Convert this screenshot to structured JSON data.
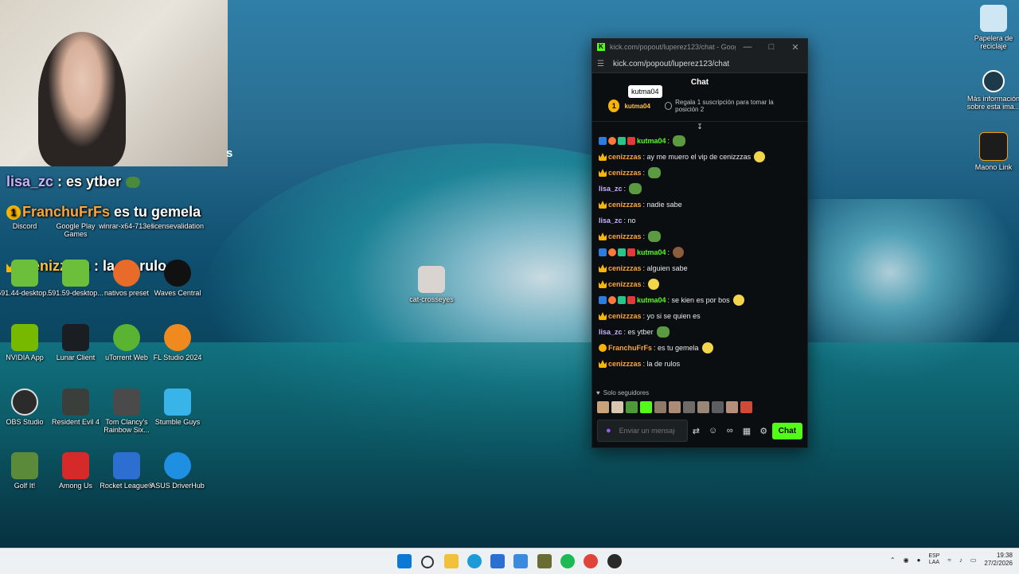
{
  "webcam": {
    "suffix": "s"
  },
  "overlay": [
    {
      "user": "lisa_zc",
      "sep": " : ",
      "text": "es ytber"
    },
    {
      "user": "FranchuFrFs",
      "sep": " ",
      "text": "es tu gemela"
    },
    {
      "user": "cenizzzas",
      "sep": " : ",
      "text": "la de rulos"
    }
  ],
  "desktop_left": [
    {
      "label": "Discord"
    },
    {
      "label": "Google Play Games"
    },
    {
      "label": "winrar-x64-713es"
    },
    {
      "label": "licensevalidation"
    },
    {
      "label": "591.44-desktop..."
    },
    {
      "label": "591.59-desktop..."
    },
    {
      "label": "nativos preset"
    },
    {
      "label": "Waves Central"
    },
    {
      "label": "NVIDIA App"
    },
    {
      "label": "Lunar Client"
    },
    {
      "label": "uTorrent Web"
    },
    {
      "label": "FL Studio 2024"
    },
    {
      "label": "OBS Studio"
    },
    {
      "label": "Resident Evil 4"
    },
    {
      "label": "Tom Clancy's Rainbow Six..."
    },
    {
      "label": "Stumble Guys"
    },
    {
      "label": "Golf It!"
    },
    {
      "label": "Among Us"
    },
    {
      "label": "Rocket League®"
    },
    {
      "label": "ASUS DriverHub"
    }
  ],
  "desktop_center": {
    "label": "cat-crosseyes"
  },
  "desktop_right": [
    {
      "label": "Papelera de reciclaje"
    },
    {
      "label": "Más información sobre esta ima..."
    },
    {
      "label": "Maono Link"
    }
  ],
  "window": {
    "title": "kick.com/popout/luperez123/chat - Google...",
    "url": "kick.com/popout/luperez123/chat",
    "header": "Chat",
    "tooltip": "kutma04",
    "pinned": {
      "rank": "1",
      "user": "kutma04",
      "gift": "Regala 1 suscripción para tomar la posición 2"
    },
    "scroll_symbol": "↧",
    "messages": [
      {
        "user": "kutma04",
        "text": ""
      },
      {
        "user": "cenizzzas",
        "text": "ay me muero el vip de cenizzzas"
      },
      {
        "user": "cenizzzas",
        "text": ""
      },
      {
        "user": "lisa_zc",
        "text": ""
      },
      {
        "user": "cenizzzas",
        "text": "nadie sabe"
      },
      {
        "user": "lisa_zc",
        "text": "no"
      },
      {
        "user": "cenizzzas",
        "text": ""
      },
      {
        "user": "kutma04",
        "text": ""
      },
      {
        "user": "cenizzzas",
        "text": "alguien sabe"
      },
      {
        "user": "cenizzzas",
        "text": ""
      },
      {
        "user": "kutma04",
        "text": "se kien es por bos"
      },
      {
        "user": "cenizzzas",
        "text": "yo si se quien es"
      },
      {
        "user": "lisa_zc",
        "text": "es ytber"
      },
      {
        "user": "FranchuFrFs",
        "text": "es tu gemela"
      },
      {
        "user": "cenizzzas",
        "text": "la de rulos"
      }
    ],
    "followers_only": "Solo seguidores",
    "input_placeholder": "Enviar un mensaje",
    "send_label": "Chat"
  },
  "taskbar": {
    "lang": "ESP",
    "lang2": "LAA",
    "time": "19:38",
    "date": "27/2/2026"
  }
}
